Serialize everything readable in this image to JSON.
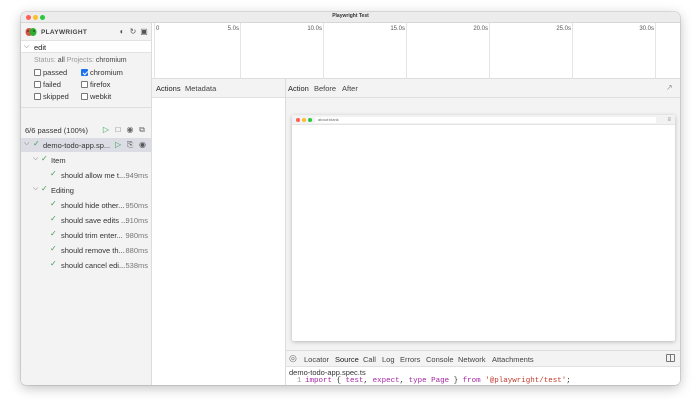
{
  "window": {
    "title": "Playwright Test"
  },
  "brand": {
    "name": "PLAYWRIGHT"
  },
  "filter": {
    "value": "edit"
  },
  "status": {
    "status_label": "Status:",
    "status_value": "all",
    "projects_label": "Projects:",
    "projects_value": "chromium"
  },
  "checkboxes": [
    {
      "label": "passed",
      "checked": false
    },
    {
      "label": "chromium",
      "checked": true
    },
    {
      "label": "failed",
      "checked": false
    },
    {
      "label": "firefox",
      "checked": false
    },
    {
      "label": "skipped",
      "checked": false
    },
    {
      "label": "webkit",
      "checked": false
    }
  ],
  "summary": {
    "passed": "6/6 passed (100%)"
  },
  "tree": {
    "file": "demo-todo-app.sp...",
    "groups": [
      {
        "name": "Item",
        "tests": [
          {
            "name": "should allow me t...",
            "duration": "949ms"
          }
        ]
      },
      {
        "name": "Editing",
        "tests": [
          {
            "name": "should hide other...",
            "duration": "950ms"
          },
          {
            "name": "should save edits ...",
            "duration": "910ms"
          },
          {
            "name": "should trim enter...",
            "duration": "980ms"
          },
          {
            "name": "should remove th...",
            "duration": "880ms"
          },
          {
            "name": "should cancel edi...",
            "duration": "538ms"
          }
        ]
      }
    ]
  },
  "timeline": {
    "labels": [
      "0",
      "5.0s",
      "10.0s",
      "15.0s",
      "20.0s",
      "25.0s",
      "30.0s"
    ]
  },
  "actions_tabs": [
    "Actions",
    "Metadata"
  ],
  "main_tabs": [
    "Action",
    "Before",
    "After"
  ],
  "browser": {
    "url": "about:blank"
  },
  "bottom_tabs": [
    "Locator",
    "Source",
    "Call",
    "Log",
    "Errors",
    "Console",
    "Network",
    "Attachments"
  ],
  "source": {
    "file": "demo-todo-app.spec.ts",
    "line_number": "1",
    "tokens": [
      "import",
      " { ",
      "test",
      ", ",
      "expect",
      ", ",
      "type",
      " ",
      "Page",
      " } ",
      "from",
      " ",
      "'@playwright/test'",
      ";"
    ]
  },
  "colors": {
    "accent": "#1a73e8",
    "pass": "#3f9b53"
  }
}
